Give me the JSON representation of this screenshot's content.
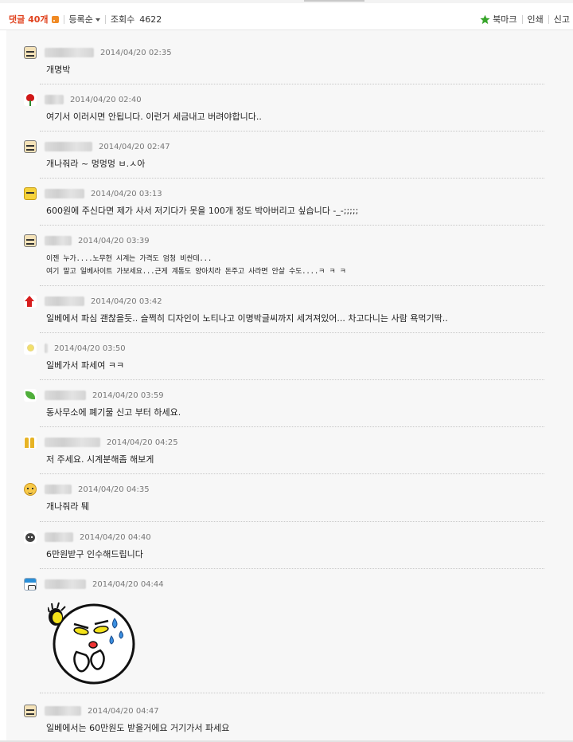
{
  "header": {
    "comment_label": "댓글 40개",
    "sort_label": "등록순",
    "views_label": "조회수",
    "views_count": "4622",
    "bookmark_label": "북마크",
    "print_label": "인쇄",
    "report_label": "신고"
  },
  "colors": {
    "accent": "#e0421e",
    "divider": "#c8c8c8",
    "background": "#f7f7f7",
    "star": "#37a52a"
  },
  "icons": {
    "rss": "rss-icon",
    "star": "star-icon",
    "caret": "chevron-down-icon"
  },
  "comments": [
    {
      "avatar": "glasses-face-icon",
      "date": "2014/04/20 02:35",
      "text": "개명박"
    },
    {
      "avatar": "rose-icon",
      "date": "2014/04/20 02:40",
      "text": "여기서 이러시면 안됩니다. 이런거 세금내고 버려야합니다.."
    },
    {
      "avatar": "glasses-face-icon",
      "date": "2014/04/20 02:47",
      "text": "개나줘라 ~ 멍멍멍 ㅂ.ㅅ아"
    },
    {
      "avatar": "yellow-face-icon",
      "date": "2014/04/20 03:13",
      "text": "600원에 주신다면 제가 사서 저기다가 못을 100개 정도 박아버리고 싶습니다 -_-;;;;;"
    },
    {
      "avatar": "glasses-face-icon",
      "date": "2014/04/20 03:39",
      "text_lines": [
        "이젠 누가....노무현 시계는 가격도 엄청 비싼데...",
        "여기 말고 일베사이트 가보세요...근게 계통도 양아치라 돈주고 사라면 안살 수도....ㅋ ㅋ ㅋ"
      ]
    },
    {
      "avatar": "red-arrow-icon",
      "date": "2014/04/20 03:42",
      "text": "일베에서 파심 괜찮을듯.. 슬쩍히 디자인이 노티나고 이명박글씨까지 세겨져있어... 차고다니는 사람 욕먹기딱.."
    },
    {
      "avatar": "flower-icon",
      "date": "2014/04/20 03:50",
      "text": "일베가서 파세여 ㅋㅋ"
    },
    {
      "avatar": "leaf-icon",
      "date": "2014/04/20 03:59",
      "text": "동사무소에 폐기물 신고 부터 하세요."
    },
    {
      "avatar": "bars-icon",
      "date": "2014/04/20 04:25",
      "text": "저 주세요. 시계분해좀 해보게"
    },
    {
      "avatar": "smile-face-icon",
      "date": "2014/04/20 04:35",
      "text": "개나줘라 퉤"
    },
    {
      "avatar": "bug-icon",
      "date": "2014/04/20 04:40",
      "text": "6만원받구 인수해드립니다"
    },
    {
      "avatar": "sign-icon",
      "date": "2014/04/20 04:44",
      "sticker": "crying-moon-emoticon"
    },
    {
      "avatar": "glasses-face-icon",
      "date": "2014/04/20 04:47",
      "text": "일베에서는 60만원도 받을거에요 거기가서 파세요"
    }
  ]
}
